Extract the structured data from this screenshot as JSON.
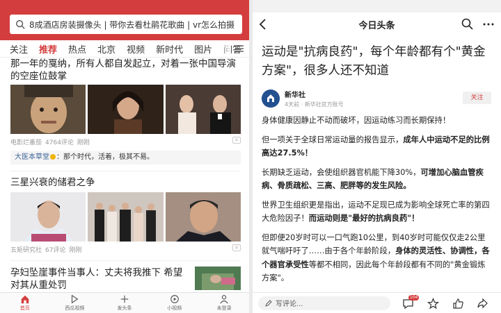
{
  "left": {
    "search": {
      "placeholder": "8成酒店房装摄像头 | 带你去看杜鹃花歌曲 | vr怎么拍摄"
    },
    "channels": [
      "关注",
      "推荐",
      "热点",
      "北京",
      "视频",
      "新时代",
      "图片",
      "问答"
    ],
    "active_channel": "推荐",
    "news": [
      {
        "title": "那一年的戛纳，所有人都自发起立，对着一张中国导演的空座位鼓掌",
        "source": "电影烂番茄",
        "comments": "4764评论",
        "time": "刚刚",
        "quote_name": "大医本草堂",
        "quote_text": "：那个时代，活着，极其不易。"
      },
      {
        "title": "三星兴衰的储君之争",
        "source": "五矩研究社",
        "comments": "67评论",
        "time": "刚刚"
      },
      {
        "title": "孕妇坠崖事件当事人：丈夫将我推下 希望对其从重处罚"
      }
    ],
    "bottom_nav": [
      {
        "label": "首页",
        "icon": "home-icon"
      },
      {
        "label": "西瓜视频",
        "icon": "play-icon"
      },
      {
        "label": "发头条",
        "icon": "plus-icon"
      },
      {
        "label": "小视频",
        "icon": "small-video-icon"
      },
      {
        "label": "未登录",
        "icon": "user-icon"
      }
    ]
  },
  "right": {
    "header": {
      "title": "今日头条"
    },
    "article": {
      "title": "运动是\"抗病良药\"，每个年龄都有个\"黄金方案\"，很多人还不知道",
      "author": "新华社",
      "author_sub": "4天前 · 新华社官方账号",
      "follow_label": "关注",
      "p1": "身体健康因静止不动而破坏，因运动练习而长期保持！",
      "p2_a": "但一项关于全球日常运动量的报告显示，",
      "p2_b": "成年人中运动不足的比例高达27.5%！",
      "p3_a": "长期缺乏运动，会使组织器官机能下降30%，",
      "p3_b": "可增加心脑血管疾病、骨质疏松、三高、肥胖等的发生风险。",
      "p4_a": "世界卫生组织更是指出，运动不足现已成为影响全球死亡率的第四大危险因子！",
      "p4_b": "而运动则是\"最好的抗病良药\"！",
      "p5_a": "但即便20岁时可以一口气跑10公里，到40岁时可能仅仅走2公里就气喘吁吁了……由于各个年龄阶段，",
      "p5_b": "身体的灵活性、协调性，各个器官承受性",
      "p5_c": "等都不相同，因此每个年龄段都有不同的\"黄金锻炼方案\"。"
    },
    "bottom": {
      "comment_placeholder": "写评论...",
      "comment_count": "104"
    }
  },
  "colors": {
    "brand_red": "#d43d3d"
  }
}
